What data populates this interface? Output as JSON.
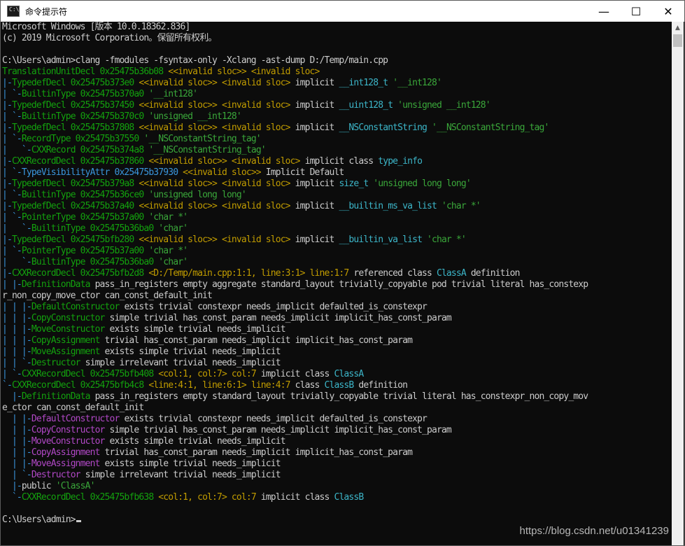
{
  "window": {
    "title": "命令提示符",
    "minimize_glyph": "—",
    "maximize_glyph": "☐",
    "close_glyph": "✕",
    "icon_text": "C:\\"
  },
  "console": {
    "lines": [
      [
        [
          "c-w",
          "Microsoft Windows [版本 10.0.18362.836]"
        ]
      ],
      [
        [
          "c-w",
          "(c) 2019 Microsoft Corporation。保留所有权利。"
        ]
      ],
      [],
      [
        [
          "c-w",
          "C:\\Users\\admin>clang -fmodules -fsyntax-only -Xclang -ast-dump D:/Temp/main.cpp"
        ]
      ],
      [
        [
          "c-g",
          "TranslationUnitDecl 0x25475b36b08 "
        ],
        [
          "c-y",
          "<<invalid sloc>> <invalid sloc>"
        ]
      ],
      [
        [
          "c-b",
          "|-"
        ],
        [
          "c-g",
          "TypedefDecl 0x25475b373e0 "
        ],
        [
          "c-y",
          "<<invalid sloc>> <invalid sloc>"
        ],
        [
          "c-w",
          " implicit "
        ],
        [
          "c-c",
          "__int128_t"
        ],
        [
          "c-gr",
          " '__int128'"
        ]
      ],
      [
        [
          "c-b",
          "| `-"
        ],
        [
          "c-g",
          "BuiltinType 0x25475b370a0 "
        ],
        [
          "c-gr",
          "'__int128'"
        ]
      ],
      [
        [
          "c-b",
          "|-"
        ],
        [
          "c-g",
          "TypedefDecl 0x25475b37450 "
        ],
        [
          "c-y",
          "<<invalid sloc>> <invalid sloc>"
        ],
        [
          "c-w",
          " implicit "
        ],
        [
          "c-c",
          "__uint128_t"
        ],
        [
          "c-gr",
          " 'unsigned __int128'"
        ]
      ],
      [
        [
          "c-b",
          "| `-"
        ],
        [
          "c-g",
          "BuiltinType 0x25475b370c0 "
        ],
        [
          "c-gr",
          "'unsigned __int128'"
        ]
      ],
      [
        [
          "c-b",
          "|-"
        ],
        [
          "c-g",
          "TypedefDecl 0x25475b37808 "
        ],
        [
          "c-y",
          "<<invalid sloc>> <invalid sloc>"
        ],
        [
          "c-w",
          " implicit "
        ],
        [
          "c-c",
          "__NSConstantString"
        ],
        [
          "c-gr",
          " '__NSConstantString_tag'"
        ]
      ],
      [
        [
          "c-b",
          "| `-"
        ],
        [
          "c-g",
          "RecordType 0x25475b37550 "
        ],
        [
          "c-gr",
          "'__NSConstantString_tag'"
        ]
      ],
      [
        [
          "c-b",
          "|   `-"
        ],
        [
          "c-g",
          "CXXRecord 0x25475b374a8 "
        ],
        [
          "c-gr",
          "'__NSConstantString_tag'"
        ]
      ],
      [
        [
          "c-b",
          "|-"
        ],
        [
          "c-g",
          "CXXRecordDecl 0x25475b37860 "
        ],
        [
          "c-y",
          "<<invalid sloc>> <invalid sloc>"
        ],
        [
          "c-w",
          " implicit class "
        ],
        [
          "c-c",
          "type_info"
        ]
      ],
      [
        [
          "c-b",
          "| `-"
        ],
        [
          "c-b",
          "TypeVisibilityAttr 0x25475b37930 "
        ],
        [
          "c-y",
          "<<invalid sloc>>"
        ],
        [
          "c-w",
          " Implicit Default"
        ]
      ],
      [
        [
          "c-b",
          "|-"
        ],
        [
          "c-g",
          "TypedefDecl 0x25475b379a8 "
        ],
        [
          "c-y",
          "<<invalid sloc>> <invalid sloc>"
        ],
        [
          "c-w",
          " implicit "
        ],
        [
          "c-c",
          "size_t"
        ],
        [
          "c-gr",
          " 'unsigned long long'"
        ]
      ],
      [
        [
          "c-b",
          "| `-"
        ],
        [
          "c-g",
          "BuiltinType 0x25475b36ce0 "
        ],
        [
          "c-gr",
          "'unsigned long long'"
        ]
      ],
      [
        [
          "c-b",
          "|-"
        ],
        [
          "c-g",
          "TypedefDecl 0x25475b37a40 "
        ],
        [
          "c-y",
          "<<invalid sloc>> <invalid sloc>"
        ],
        [
          "c-w",
          " implicit "
        ],
        [
          "c-c",
          "__builtin_ms_va_list"
        ],
        [
          "c-gr",
          " 'char *'"
        ]
      ],
      [
        [
          "c-b",
          "| `-"
        ],
        [
          "c-g",
          "PointerType 0x25475b37a00 "
        ],
        [
          "c-gr",
          "'char *'"
        ]
      ],
      [
        [
          "c-b",
          "|   `-"
        ],
        [
          "c-g",
          "BuiltinType 0x25475b36ba0 "
        ],
        [
          "c-gr",
          "'char'"
        ]
      ],
      [
        [
          "c-b",
          "|-"
        ],
        [
          "c-g",
          "TypedefDecl 0x25475bfb280 "
        ],
        [
          "c-y",
          "<<invalid sloc>> <invalid sloc>"
        ],
        [
          "c-w",
          " implicit "
        ],
        [
          "c-c",
          "__builtin_va_list"
        ],
        [
          "c-gr",
          " 'char *'"
        ]
      ],
      [
        [
          "c-b",
          "| `-"
        ],
        [
          "c-g",
          "PointerType 0x25475b37a00 "
        ],
        [
          "c-gr",
          "'char *'"
        ]
      ],
      [
        [
          "c-b",
          "|   `-"
        ],
        [
          "c-g",
          "BuiltinType 0x25475b36ba0 "
        ],
        [
          "c-gr",
          "'char'"
        ]
      ],
      [
        [
          "c-b",
          "|-"
        ],
        [
          "c-g",
          "CXXRecordDecl 0x25475bfb2d8 "
        ],
        [
          "c-y",
          "<D:/Temp/main.cpp:1:1, line:3:1> line:1:7"
        ],
        [
          "c-w",
          " referenced class "
        ],
        [
          "c-c",
          "ClassA"
        ],
        [
          "c-w",
          " definition"
        ]
      ],
      [
        [
          "c-b",
          "| |-"
        ],
        [
          "c-g",
          "DefinitionData "
        ],
        [
          "c-w",
          "pass_in_registers empty aggregate standard_layout trivially_copyable pod trivial literal has_constexp"
        ]
      ],
      [
        [
          "c-w",
          "r_non_copy_move_ctor can_const_default_init"
        ]
      ],
      [
        [
          "c-b",
          "| | |-"
        ],
        [
          "c-g",
          "DefaultConstructor "
        ],
        [
          "c-w",
          "exists trivial constexpr needs_implicit defaulted_is_constexpr"
        ]
      ],
      [
        [
          "c-b",
          "| | |-"
        ],
        [
          "c-g",
          "CopyConstructor "
        ],
        [
          "c-w",
          "simple trivial has_const_param needs_implicit implicit_has_const_param"
        ]
      ],
      [
        [
          "c-b",
          "| | |-"
        ],
        [
          "c-g",
          "MoveConstructor "
        ],
        [
          "c-w",
          "exists simple trivial needs_implicit"
        ]
      ],
      [
        [
          "c-b",
          "| | |-"
        ],
        [
          "c-g",
          "CopyAssignment "
        ],
        [
          "c-w",
          "trivial has_const_param needs_implicit implicit_has_const_param"
        ]
      ],
      [
        [
          "c-b",
          "| | |-"
        ],
        [
          "c-g",
          "MoveAssignment "
        ],
        [
          "c-w",
          "exists simple trivial needs_implicit"
        ]
      ],
      [
        [
          "c-b",
          "| | `-"
        ],
        [
          "c-g",
          "Destructor "
        ],
        [
          "c-w",
          "simple irrelevant trivial needs_implicit"
        ]
      ],
      [
        [
          "c-b",
          "| `-"
        ],
        [
          "c-g",
          "CXXRecordDecl 0x25475bfb408 "
        ],
        [
          "c-y",
          "<col:1, col:7> col:7"
        ],
        [
          "c-w",
          " implicit class "
        ],
        [
          "c-c",
          "ClassA"
        ]
      ],
      [
        [
          "c-b",
          "`-"
        ],
        [
          "c-g",
          "CXXRecordDecl 0x25475bfb4c8 "
        ],
        [
          "c-y",
          "<line:4:1, line:6:1> line:4:7"
        ],
        [
          "c-w",
          " class "
        ],
        [
          "c-c",
          "ClassB"
        ],
        [
          "c-w",
          " definition"
        ]
      ],
      [
        [
          "c-b",
          "  |-"
        ],
        [
          "c-g",
          "DefinitionData "
        ],
        [
          "c-w",
          "pass_in_registers empty standard_layout trivially_copyable trivial literal has_constexpr_non_copy_mov"
        ]
      ],
      [
        [
          "c-w",
          "e_ctor can_const_default_init"
        ]
      ],
      [
        [
          "c-b",
          "  | |-"
        ],
        [
          "c-m",
          "DefaultConstructor "
        ],
        [
          "c-w",
          "exists trivial constexpr needs_implicit defaulted_is_constexpr"
        ]
      ],
      [
        [
          "c-b",
          "  | |-"
        ],
        [
          "c-m",
          "CopyConstructor "
        ],
        [
          "c-w",
          "simple trivial has_const_param needs_implicit implicit_has_const_param"
        ]
      ],
      [
        [
          "c-b",
          "  | |-"
        ],
        [
          "c-m",
          "MoveConstructor "
        ],
        [
          "c-w",
          "exists simple trivial needs_implicit"
        ]
      ],
      [
        [
          "c-b",
          "  | |-"
        ],
        [
          "c-m",
          "CopyAssignment "
        ],
        [
          "c-w",
          "trivial has_const_param needs_implicit implicit_has_const_param"
        ]
      ],
      [
        [
          "c-b",
          "  | |-"
        ],
        [
          "c-m",
          "MoveAssignment "
        ],
        [
          "c-w",
          "exists simple trivial needs_implicit"
        ]
      ],
      [
        [
          "c-b",
          "  | `-"
        ],
        [
          "c-m",
          "Destructor "
        ],
        [
          "c-w",
          "simple irrelevant trivial needs_implicit"
        ]
      ],
      [
        [
          "c-b",
          "  |-"
        ],
        [
          "c-w",
          "public "
        ],
        [
          "c-gr",
          "'ClassA'"
        ]
      ],
      [
        [
          "c-b",
          "  `-"
        ],
        [
          "c-g",
          "CXXRecordDecl 0x25475bfb638 "
        ],
        [
          "c-y",
          "<col:1, col:7> col:7"
        ],
        [
          "c-w",
          " implicit class "
        ],
        [
          "c-c",
          "ClassB"
        ]
      ],
      [],
      [
        [
          "c-w",
          "C:\\Users\\admin>"
        ]
      ]
    ]
  },
  "watermark": "https://blog.csdn.net/u01341239"
}
